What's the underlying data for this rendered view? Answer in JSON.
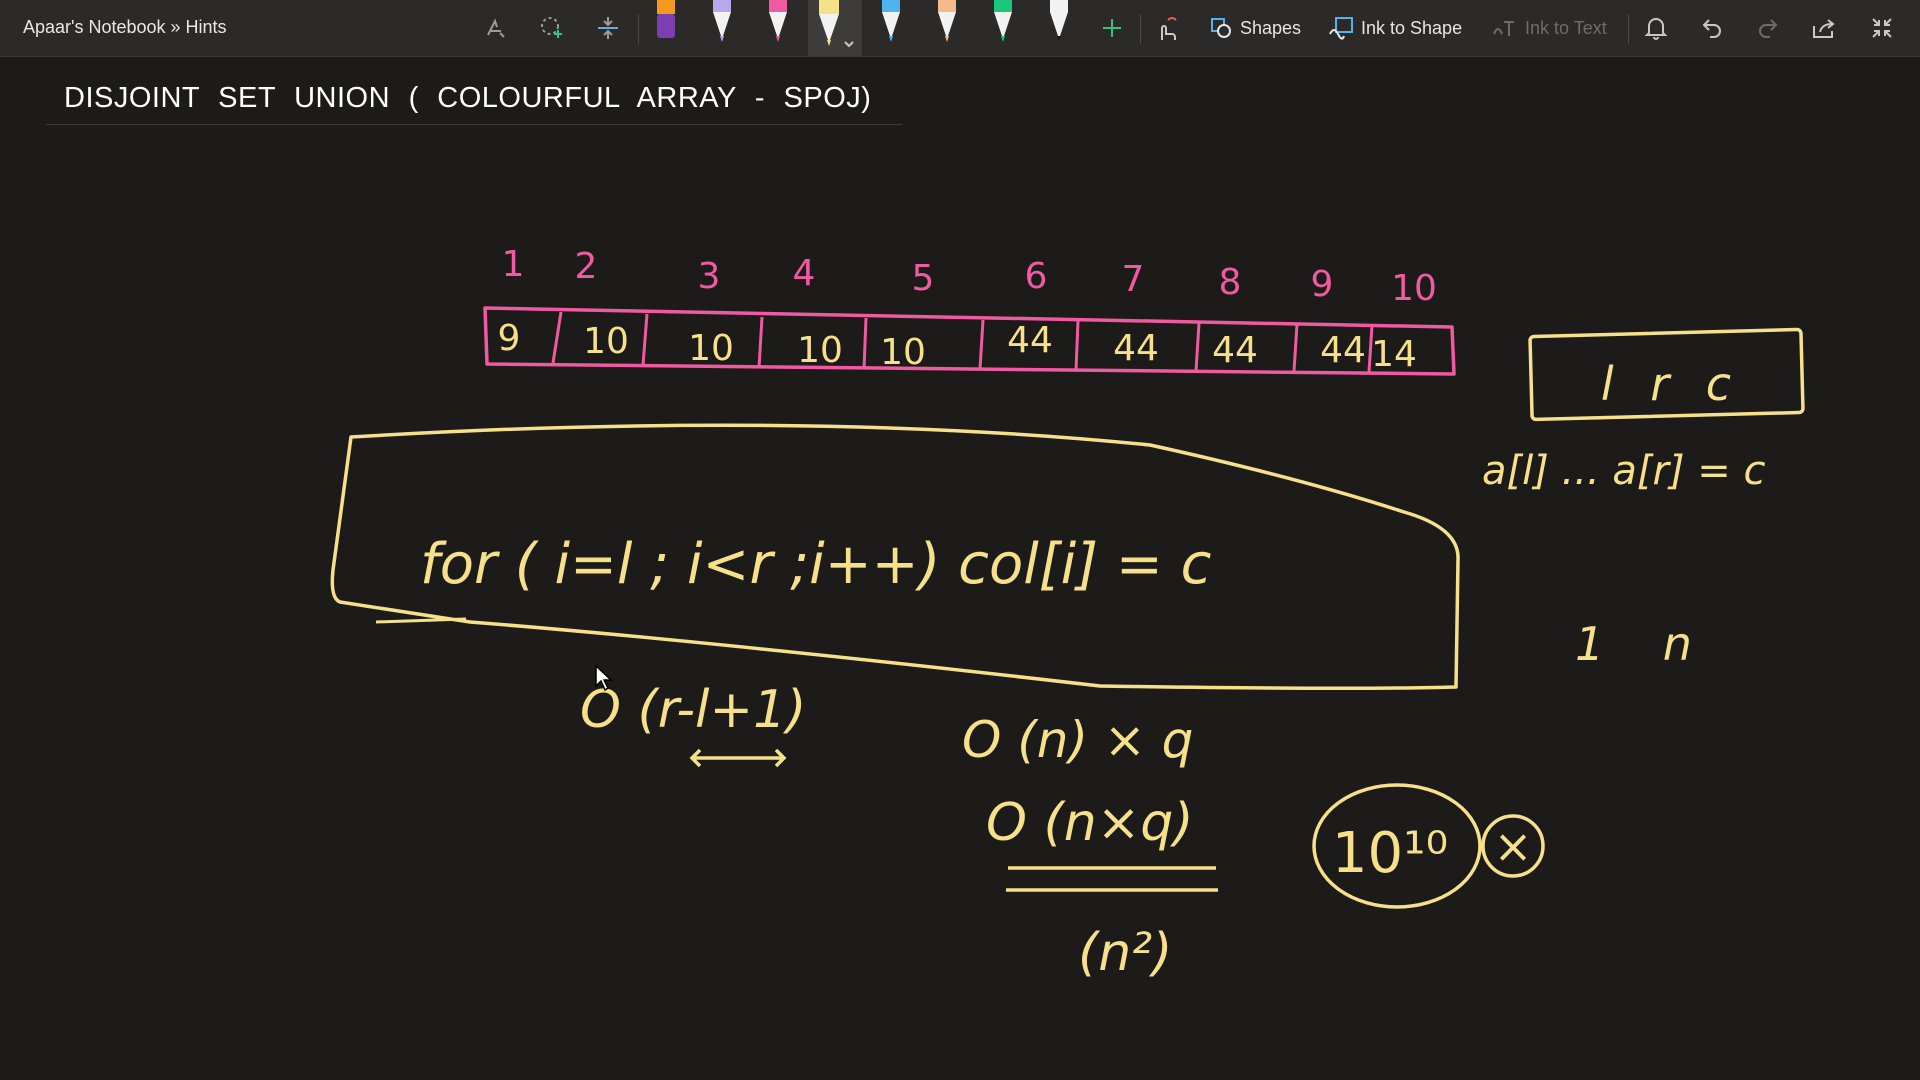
{
  "notebook": {
    "breadcrumb": "Apaar's Notebook » Hints"
  },
  "toolbar": {
    "shapes_label": "Shapes",
    "ink_to_shape_label": "Ink to Shape",
    "ink_to_text_label": "Ink to Text",
    "pens": [
      {
        "name": "pen-orange",
        "color": "#f59a1e"
      },
      {
        "name": "pen-lavender",
        "color": "#b9a7ec"
      },
      {
        "name": "pen-pink",
        "color": "#ef5aa0"
      },
      {
        "name": "pen-yellow",
        "color": "#f7e08a"
      },
      {
        "name": "pen-blue",
        "color": "#4fb3ef"
      },
      {
        "name": "pen-peach",
        "color": "#f5b98e"
      },
      {
        "name": "pen-green",
        "color": "#19c67a"
      },
      {
        "name": "pen-white",
        "color": "#f2f2f2"
      }
    ]
  },
  "page": {
    "title": "DISJOINT SET UNION ( COLOURFUL ARRAY - SPOJ)"
  },
  "ink": {
    "indices": [
      "1",
      "2",
      "3",
      "4",
      "5",
      "6",
      "7",
      "8",
      "9",
      "10"
    ],
    "array_values": [
      "9",
      "10",
      "10",
      "10",
      "10",
      "44",
      "44",
      "44",
      "44",
      "14"
    ],
    "query_box": "l r c",
    "query_meaning": "a[l] ... a[r] = c",
    "loop_code": "for ( i=l ; i<r ;i++)  col[i] = c",
    "range_bounds": "1    n",
    "cost_per_query": "O (r-l+1)",
    "cost_total": "O (n) × q",
    "cost_product": "O (n×q)",
    "cost_square": "(n²)",
    "ops_estimate": "10¹⁰",
    "rejected_mark": "×"
  },
  "colors": {
    "ink_yellow": "#f7e08a",
    "ink_pink": "#ef5aa0",
    "background": "#1c1b1a"
  }
}
